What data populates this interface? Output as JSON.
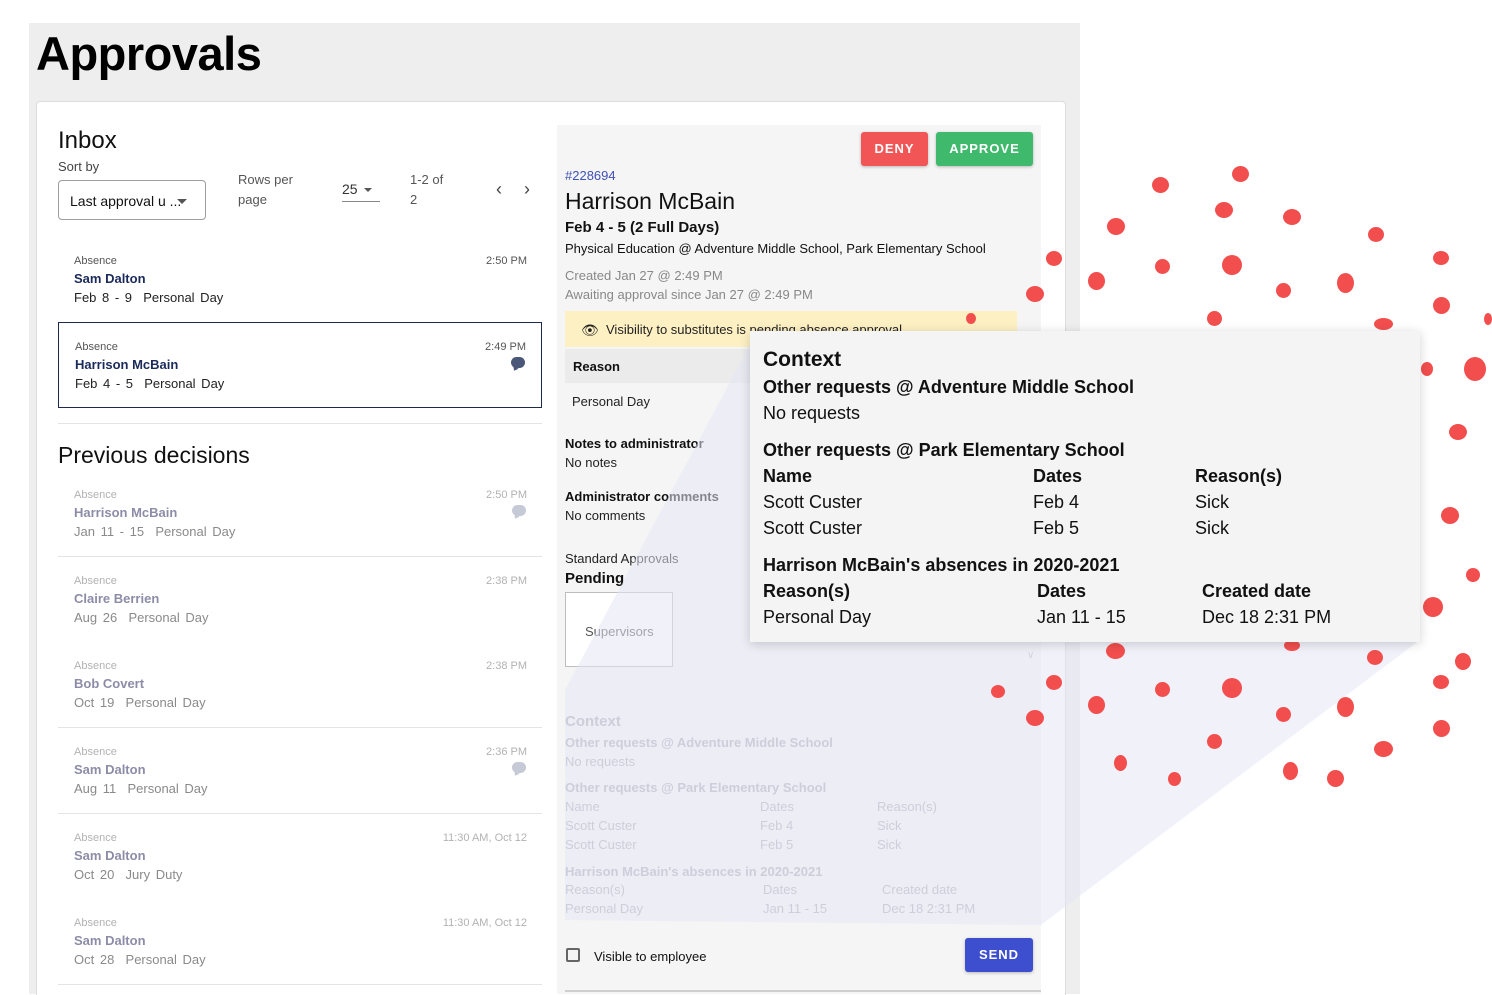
{
  "page": {
    "title": "Approvals"
  },
  "inbox": {
    "title": "Inbox",
    "sort_label": "Sort by",
    "sort_value": "Last approval u ...",
    "rows_per_page_label": "Rows per page",
    "rows_per_page_value": "25",
    "range": "1-2 of 2",
    "items": [
      {
        "type": "Absence",
        "name": "Sam Dalton",
        "dates": "Feb 8 - 9",
        "reason": "Personal Day",
        "time": "2:50 PM",
        "has_comment": false,
        "selected": false
      },
      {
        "type": "Absence",
        "name": "Harrison McBain",
        "dates": "Feb 4 - 5",
        "reason": "Personal Day",
        "time": "2:49 PM",
        "has_comment": true,
        "selected": true
      }
    ]
  },
  "previous": {
    "title": "Previous decisions",
    "items": [
      {
        "type": "Absence",
        "name": "Harrison McBain",
        "dates": "Jan 11 - 15",
        "reason": "Personal Day",
        "time": "2:50 PM",
        "has_comment": true
      },
      {
        "type": "Absence",
        "name": "Claire Berrien",
        "dates": "Aug 26",
        "reason": "Personal Day",
        "time": "2:38 PM",
        "has_comment": false
      },
      {
        "type": "Absence",
        "name": "Bob Covert",
        "dates": "Oct 19",
        "reason": "Personal Day",
        "time": "2:38 PM",
        "has_comment": false
      },
      {
        "type": "Absence",
        "name": "Sam Dalton",
        "dates": "Aug 11",
        "reason": "Personal Day",
        "time": "2:36 PM",
        "has_comment": true
      },
      {
        "type": "Absence",
        "name": "Sam Dalton",
        "dates": "Oct 20",
        "reason": "Jury Duty",
        "time": "11:30 AM, Oct 12",
        "has_comment": false
      },
      {
        "type": "Absence",
        "name": "Sam Dalton",
        "dates": "Oct 28",
        "reason": "Personal Day",
        "time": "11:30 AM, Oct 12",
        "has_comment": false
      }
    ]
  },
  "detail": {
    "deny_label": "DENY",
    "approve_label": "APPROVE",
    "request_id": "#228694",
    "employee": "Harrison McBain",
    "dates": "Feb 4 - 5 (2 Full Days)",
    "position": "Physical Education @ Adventure Middle School, Park Elementary School",
    "created": "Created Jan 27 @ 2:49 PM",
    "awaiting": "Awaiting approval since Jan 27 @ 2:49 PM",
    "visibility_notice": "Visibility to substitutes is pending absence approval",
    "reason_header": "Reason",
    "reason_value": "Personal Day",
    "notes_label": "Notes to administrator",
    "notes_value": "No notes",
    "admin_comments_label": "Administrator comments",
    "admin_comments_value": "No comments",
    "workflow_label": "Standard Approvals",
    "workflow_status": "Pending",
    "workflow_step": "Supervisors",
    "visible_to_employee_label": "Visible to employee",
    "send_label": "SEND"
  },
  "context": {
    "title": "Context",
    "school1_heading": "Other requests @ Adventure Middle School",
    "school1_value": "No requests",
    "school2_heading": "Other requests @ Park Elementary School",
    "school2_columns": [
      "Name",
      "Dates",
      "Reason(s)"
    ],
    "school2_rows": [
      [
        "Scott Custer",
        "Feb 4",
        "Sick"
      ],
      [
        "Scott Custer",
        "Feb 5",
        "Sick"
      ]
    ],
    "absences_heading": "Harrison McBain's absences in 2020-2021",
    "absences_columns": [
      "Reason(s)",
      "Dates",
      "Created date"
    ],
    "absences_rows": [
      [
        "Personal Day",
        "Jan 11 - 15",
        "Dec 18 2:31 PM"
      ]
    ]
  },
  "colors": {
    "deny": "#f25555",
    "approve": "#3fb96c",
    "send": "#3d4ecf",
    "link": "#3f51b5",
    "decoration": "#f24e4e",
    "banner": "#fdf0c3"
  }
}
